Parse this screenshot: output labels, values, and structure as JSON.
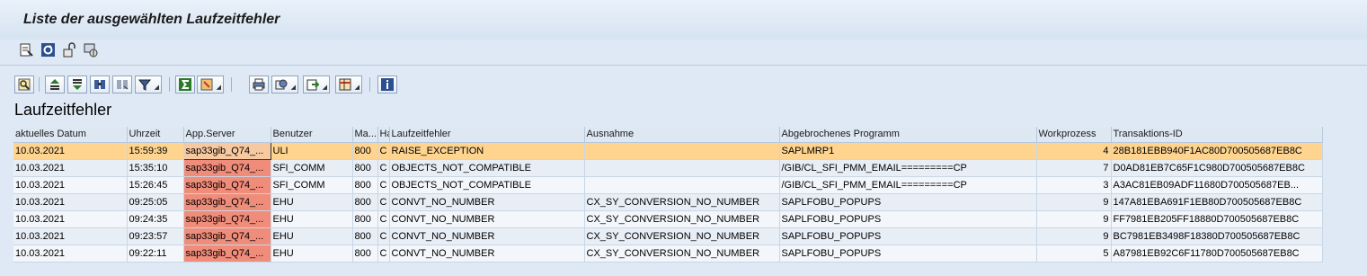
{
  "window": {
    "title": "Liste der ausgewählten Laufzeitfehler"
  },
  "app_toolbar": {
    "icons": [
      "display-icon",
      "refresh-icon",
      "unlock-icon",
      "debug-icon"
    ]
  },
  "alv_toolbar": {
    "buttons": [
      "details-icon",
      "sort-ascending-icon",
      "sort-descending-icon",
      "find-icon",
      "find-next-icon",
      "filter-icon",
      "sum-icon",
      "subtotal-icon",
      "print-icon",
      "views-icon",
      "export-icon",
      "layout-icon",
      "info-icon"
    ]
  },
  "list_title": "Laufzeitfehler",
  "table": {
    "columns": [
      "aktuelles Datum",
      "Uhrzeit",
      "App.Server",
      "Benutzer",
      "Ma...",
      "Ha",
      "Laufzeitfehler",
      "Ausnahme",
      "Abgebrochenes Programm",
      "Workprozess",
      "Transaktions-ID"
    ],
    "rows": [
      [
        "10.03.2021",
        "15:59:39",
        "sap33gib_Q74_...",
        "ULI",
        "800",
        "C",
        "RAISE_EXCEPTION",
        "",
        "SAPLMRP1",
        "4",
        "28B181EBB940F1AC80D700505687EB8C"
      ],
      [
        "10.03.2021",
        "15:35:10",
        "sap33gib_Q74_...",
        "SFI_COMM",
        "800",
        "C",
        "OBJECTS_NOT_COMPATIBLE",
        "",
        "/GIB/CL_SFI_PMM_EMAIL=========CP",
        "7",
        "D0AD81EB7C65F1C980D700505687EB8C"
      ],
      [
        "10.03.2021",
        "15:26:45",
        "sap33gib_Q74_...",
        "SFI_COMM",
        "800",
        "C",
        "OBJECTS_NOT_COMPATIBLE",
        "",
        "/GIB/CL_SFI_PMM_EMAIL=========CP",
        "3",
        "A3AC81EB09ADF11680D700505687EB..."
      ],
      [
        "10.03.2021",
        "09:25:05",
        "sap33gib_Q74_...",
        "EHU",
        "800",
        "C",
        "CONVT_NO_NUMBER",
        "CX_SY_CONVERSION_NO_NUMBER",
        "SAPLFOBU_POPUPS",
        "9",
        "147A81EBA691F1EB80D700505687EB8C"
      ],
      [
        "10.03.2021",
        "09:24:35",
        "sap33gib_Q74_...",
        "EHU",
        "800",
        "C",
        "CONVT_NO_NUMBER",
        "CX_SY_CONVERSION_NO_NUMBER",
        "SAPLFOBU_POPUPS",
        "9",
        "FF7981EB205FF18880D700505687EB8C"
      ],
      [
        "10.03.2021",
        "09:23:57",
        "sap33gib_Q74_...",
        "EHU",
        "800",
        "C",
        "CONVT_NO_NUMBER",
        "CX_SY_CONVERSION_NO_NUMBER",
        "SAPLFOBU_POPUPS",
        "9",
        "BC7981EB3498F18380D700505687EB8C"
      ],
      [
        "10.03.2021",
        "09:22:11",
        "sap33gib_Q74_...",
        "EHU",
        "800",
        "C",
        "CONVT_NO_NUMBER",
        "CX_SY_CONVERSION_NO_NUMBER",
        "SAPLFOBU_POPUPS",
        "5",
        "A87981EB92C6F11780D700505687EB8C"
      ]
    ],
    "selected_row": 0
  },
  "colors": {
    "selected_row": "#ffd48f",
    "app_server_highlight": "#f08c7a",
    "header_bg": "#dee8f3"
  }
}
